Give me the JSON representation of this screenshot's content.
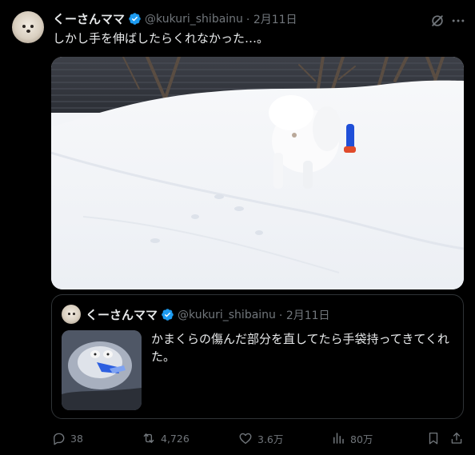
{
  "tweet": {
    "display_name": "くーさんママ",
    "handle": "@kukuri_shibainu",
    "date": "· 2月11日",
    "text": "しかし手を伸ばしたらくれなかった…。"
  },
  "quote": {
    "display_name": "くーさんママ",
    "handle": "@kukuri_shibainu",
    "date": "· 2月11日",
    "text": "かまくらの傷んだ部分を直してたら手袋持ってきてくれた。"
  },
  "actions": {
    "replies": "38",
    "reposts": "4,726",
    "likes": "3.6万",
    "views": "80万"
  },
  "icons": {
    "verified": "verified-badge-icon",
    "grok": "grok-icon",
    "more": "more-icon",
    "reply": "reply-icon",
    "repost": "repost-icon",
    "like": "heart-icon",
    "views": "views-icon",
    "bookmark": "bookmark-icon",
    "share": "share-icon"
  },
  "colors": {
    "background": "#000000",
    "text": "#e7e9ea",
    "secondary": "#71767b",
    "verified": "#1d9bf0",
    "border": "#2f3336"
  }
}
